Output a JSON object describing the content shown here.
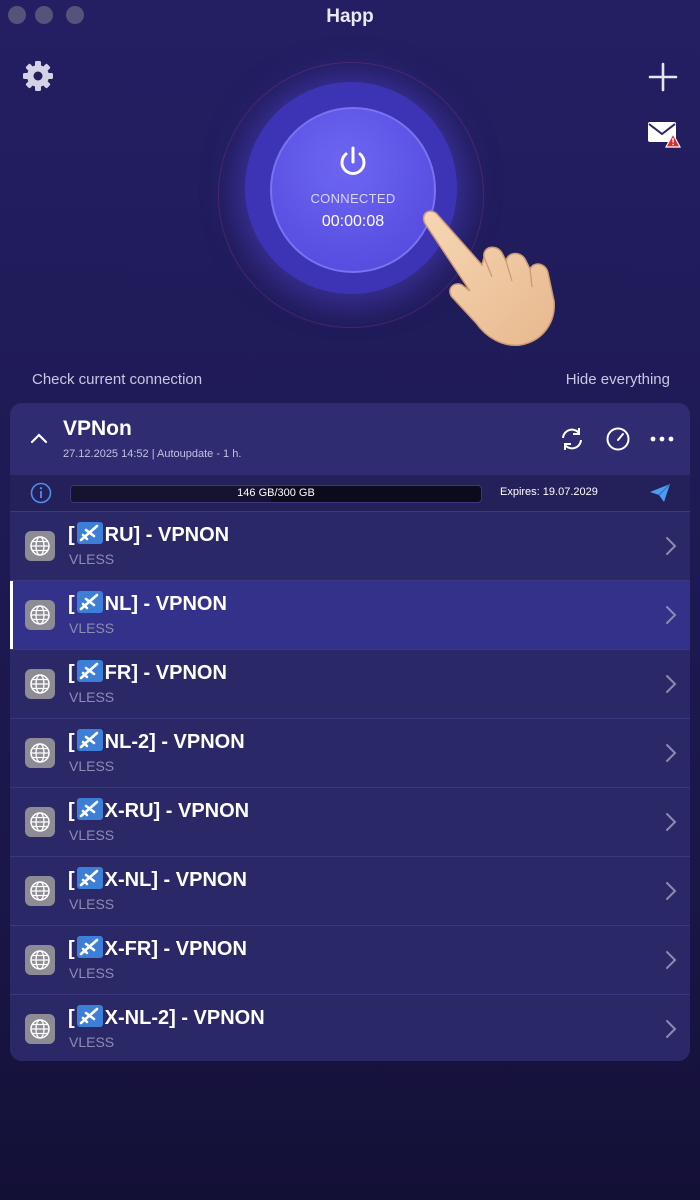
{
  "window": {
    "title": "Happ"
  },
  "connection": {
    "status": "CONNECTED",
    "timer": "00:00:08",
    "check_link": "Check current connection",
    "hide_link": "Hide everything"
  },
  "subscription": {
    "name": "VPNon",
    "meta": "27.12.2025 14:52 | Autoupdate - 1 h.",
    "traffic_label": "146 GB/300 GB",
    "traffic_used_fraction": 0.487,
    "expires": "Expires: 19.07.2029"
  },
  "servers": [
    {
      "flag": "[",
      "name": "RU] - VPNON",
      "protocol": "VLESS"
    },
    {
      "flag": "[",
      "name": "NL] - VPNON",
      "protocol": "VLESS"
    },
    {
      "flag": "[",
      "name": "FR] - VPNON",
      "protocol": "VLESS"
    },
    {
      "flag": "[",
      "name": "NL-2] - VPNON",
      "protocol": "VLESS"
    },
    {
      "flag": "[",
      "name": "X-RU] - VPNON",
      "protocol": "VLESS"
    },
    {
      "flag": "[",
      "name": "X-NL] - VPNON",
      "protocol": "VLESS"
    },
    {
      "flag": "[",
      "name": "X-FR] - VPNON",
      "protocol": "VLESS"
    },
    {
      "flag": "[",
      "name": "X-NL-2] - VPNON",
      "protocol": "VLESS"
    }
  ],
  "selected_server_index": 1,
  "icons": {
    "settings": "gear-icon",
    "add": "plus-icon",
    "mail": "mail-alert-icon",
    "power": "power-icon",
    "pointer": "pointing-hand-icon",
    "collapse": "chevron-up-icon",
    "refresh": "refresh-icon",
    "speed": "speedometer-icon",
    "more": "more-icon",
    "info": "info-icon",
    "send": "telegram-send-icon",
    "server": "globe-icon",
    "server_flag": "airplane-icon",
    "row_chevron": "chevron-right-icon"
  },
  "colors": {
    "accent": "#5b52e4",
    "background": "#1e1a55",
    "card": "#2b2868",
    "send": "#4a9df0"
  }
}
